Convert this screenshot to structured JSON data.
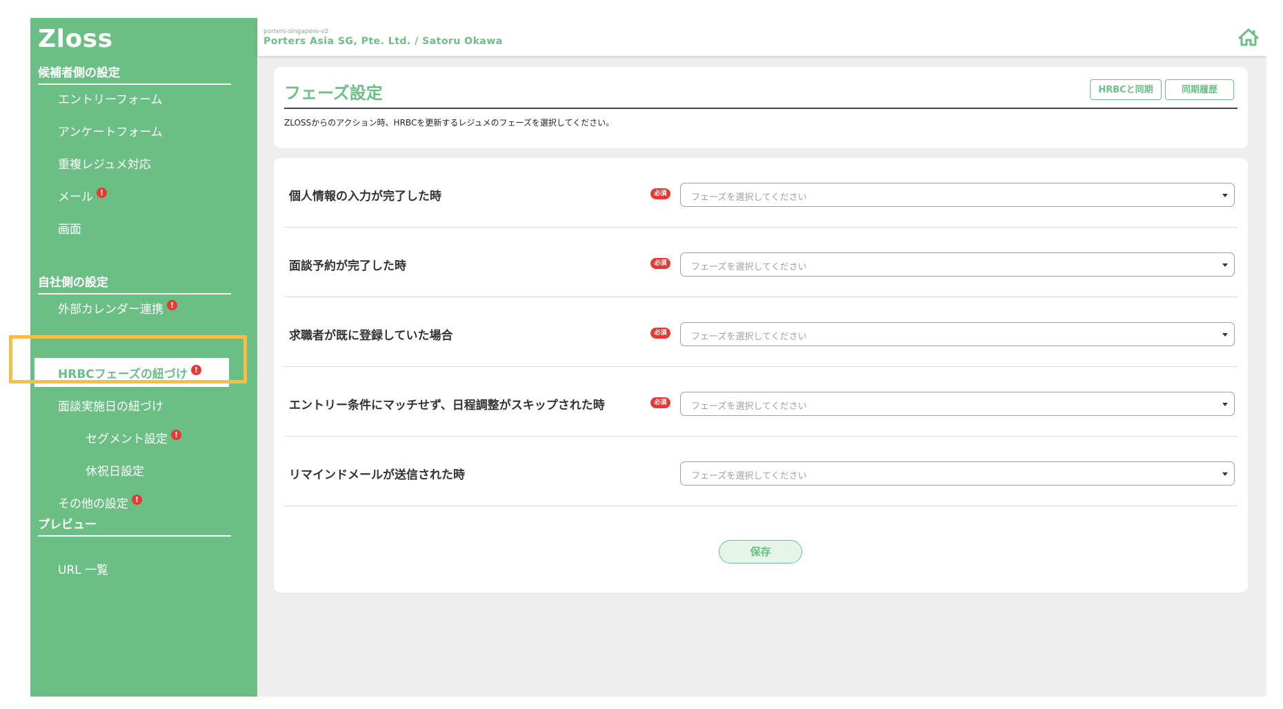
{
  "sidebar": {
    "logo": "Zloss",
    "section_candidate": "候補者側の設定",
    "candidate_items": [
      {
        "label": "エントリーフォーム",
        "alert": false
      },
      {
        "label": "アンケートフォーム",
        "alert": false
      },
      {
        "label": "重複レジュメ対応",
        "alert": false
      },
      {
        "label": "メール",
        "alert": true
      },
      {
        "label": "画面",
        "alert": false
      }
    ],
    "section_company": "自社側の設定",
    "company_items": [
      {
        "label": "外部カレンダー連携",
        "alert": true
      },
      {
        "label": "HRBCフェーズの紐づけ",
        "alert": true,
        "active": true
      },
      {
        "label": "面談実施日の紐づけ",
        "alert": false
      },
      {
        "label": "セグメント設定",
        "alert": true
      },
      {
        "label": "休祝日設定",
        "alert": false
      },
      {
        "label": "その他の設定",
        "alert": true
      }
    ],
    "section_preview": "プレビュー",
    "preview_items": [
      {
        "label": "URL 一覧",
        "alert": false
      }
    ],
    "alert_glyph": "!"
  },
  "topbar": {
    "tenant": "porters-singapore-v2",
    "company": "Porters Asia SG, Pte. Ltd. / Satoru Okawa",
    "home_icon": "home-icon"
  },
  "header": {
    "title": "フェーズ設定",
    "sync_button": "HRBCと同期",
    "history_button": "同期履歴",
    "description": "ZLOSSからのアクション時、HRBCを更新するレジュメのフェーズを選択してください。"
  },
  "form": {
    "required_badge": "必須",
    "placeholder": "フェーズを選択してください",
    "rows": [
      {
        "label": "個人情報の入力が完了した時",
        "required": true
      },
      {
        "label": "面談予約が完了した時",
        "required": true
      },
      {
        "label": "求職者が既に登録していた場合",
        "required": true
      },
      {
        "label": "エントリー条件にマッチせず、日程調整がスキップされた時",
        "required": true
      },
      {
        "label": "リマインドメールが送信された時",
        "required": false
      }
    ],
    "save_button": "保存"
  },
  "colors": {
    "brand_green": "#6cbf84",
    "alert_red": "#e53935",
    "highlight_yellow": "#f5c042"
  }
}
